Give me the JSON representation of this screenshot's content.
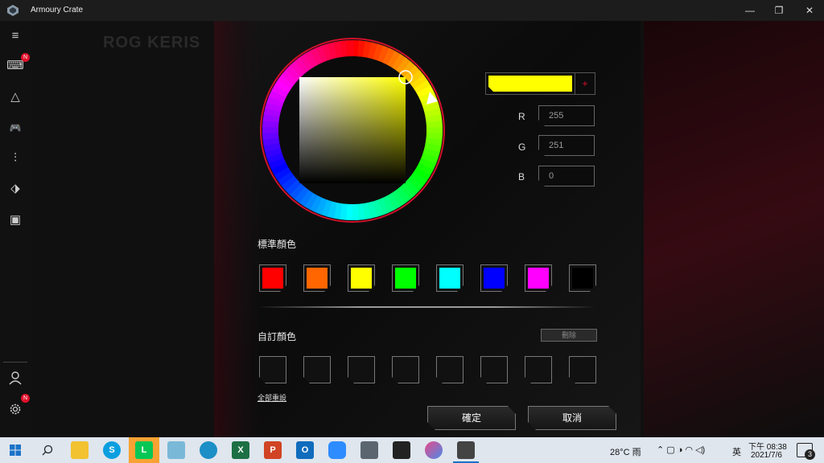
{
  "window": {
    "title": "Armoury Crate",
    "controls": [
      "—",
      "❐",
      "✕"
    ]
  },
  "sidebar": {
    "items": [
      {
        "name": "menu-icon",
        "glyph": "≡"
      },
      {
        "name": "keyboard-device-icon",
        "glyph": "⌨"
      },
      {
        "name": "aura-sync-icon",
        "glyph": "△"
      },
      {
        "name": "gamepad-icon",
        "glyph": "🎮"
      },
      {
        "name": "equalizer-icon",
        "glyph": "⫶"
      },
      {
        "name": "tag-icon",
        "glyph": "⬗"
      },
      {
        "name": "media-icon",
        "glyph": "▣"
      }
    ],
    "badge_new": "N",
    "user_icon": "user-icon",
    "settings_icon": "gear-icon"
  },
  "background": {
    "header_text": "ROG KERIS"
  },
  "picker": {
    "selected_color": "#ffff00",
    "add_label": "+",
    "rgb": {
      "r_label": "R",
      "r_value": "255",
      "g_label": "G",
      "g_value": "251",
      "b_label": "B",
      "b_value": "0"
    },
    "standard_label": "標準顏色",
    "standard_colors": [
      "#ff0000",
      "#ff6600",
      "#ffff00",
      "#00ff00",
      "#00ffff",
      "#0000ff",
      "#ff00ff",
      "#000000"
    ],
    "custom_label": "自訂顏色",
    "delete_label": "刪除",
    "reset_label": "全部重設",
    "ok_label": "確定",
    "cancel_label": "取消"
  },
  "taskbar": {
    "weather": "28°C 雨",
    "ime": "英",
    "time": "下午 08:38",
    "date": "2021/7/6",
    "notification_count": "3",
    "apps": [
      "windows",
      "search",
      "file-explorer",
      "skype",
      "line",
      "sticky",
      "edge",
      "excel",
      "powerpoint",
      "outlook",
      "zoom",
      "calculator",
      "sticky-notes",
      "paint",
      "armoury-crate"
    ]
  }
}
